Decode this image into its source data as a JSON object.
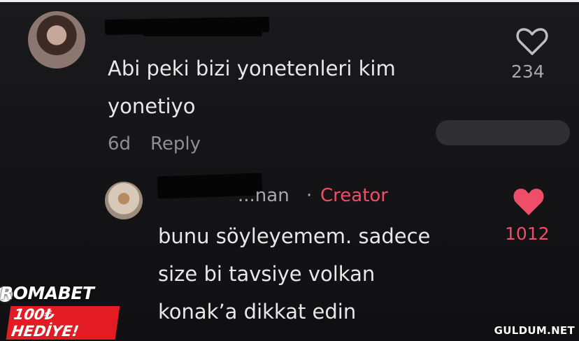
{
  "comment1": {
    "line1": "Abi peki bizi yonetenleri kim",
    "line2": "yonetiyo",
    "age": "6d",
    "reply_label": "Reply",
    "likes": "234"
  },
  "comment2": {
    "username_visible": "...nan",
    "separator": "·",
    "creator_label": "Creator",
    "line1": "bunu söyleyemem. sadece",
    "line2": "size bi tavsiye volkan",
    "line3": "konak’a dikkat edin",
    "likes": "1012"
  },
  "overlay": {
    "logo_line1": "ROMABET",
    "logo_line2": "100₺ HEDİYE!",
    "watermark": "GULDUM.NET"
  },
  "colors": {
    "background": "#141416",
    "creator": "#ee4e67",
    "liked_heart": "#ee4e67",
    "muted": "#8e8e93"
  },
  "icons": {
    "like_outline": "heart-outline-icon",
    "like_filled": "heart-filled-icon"
  }
}
